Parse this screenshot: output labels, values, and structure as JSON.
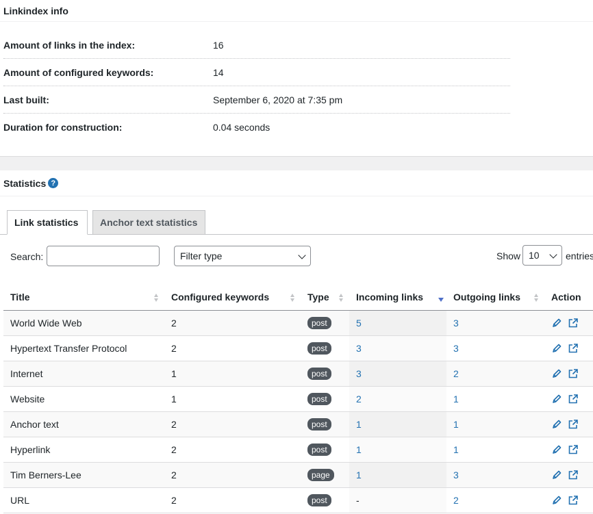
{
  "info": {
    "title": "Linkindex info",
    "rows": [
      {
        "label": "Amount of links in the index:",
        "value": "16"
      },
      {
        "label": "Amount of configured keywords:",
        "value": "14"
      },
      {
        "label": "Last built:",
        "value": "September 6, 2020 at 7:35 pm"
      },
      {
        "label": "Duration for construction:",
        "value": "0.04 seconds"
      }
    ]
  },
  "statistics": {
    "title": "Statistics",
    "help_icon": "?",
    "tabs": [
      "Link statistics",
      "Anchor text statistics"
    ],
    "active_tab": 0,
    "search_label": "Search:",
    "search_value": "",
    "filter_value": "Filter type",
    "show_label": "Show",
    "length_value": "10",
    "entries_label": "entries",
    "columns": [
      "Title",
      "Configured keywords",
      "Type",
      "Incoming links",
      "Outgoing links",
      "Action"
    ],
    "rows": [
      {
        "title": "World Wide Web",
        "keywords": "2",
        "type": "post",
        "incoming": "5",
        "outgoing": "3"
      },
      {
        "title": "Hypertext Transfer Protocol",
        "keywords": "2",
        "type": "post",
        "incoming": "3",
        "outgoing": "3"
      },
      {
        "title": "Internet",
        "keywords": "1",
        "type": "post",
        "incoming": "3",
        "outgoing": "2"
      },
      {
        "title": "Website",
        "keywords": "1",
        "type": "post",
        "incoming": "2",
        "outgoing": "1"
      },
      {
        "title": "Anchor text",
        "keywords": "2",
        "type": "post",
        "incoming": "1",
        "outgoing": "1"
      },
      {
        "title": "Hyperlink",
        "keywords": "2",
        "type": "post",
        "incoming": "1",
        "outgoing": "1"
      },
      {
        "title": "Tim Berners-Lee",
        "keywords": "2",
        "type": "page",
        "incoming": "1",
        "outgoing": "3"
      },
      {
        "title": "URL",
        "keywords": "2",
        "type": "post",
        "incoming": "-",
        "outgoing": "2"
      }
    ]
  },
  "colors": {
    "accent": "#2271b1",
    "badge": "#50575e",
    "sort_active": "#4f70c8"
  }
}
